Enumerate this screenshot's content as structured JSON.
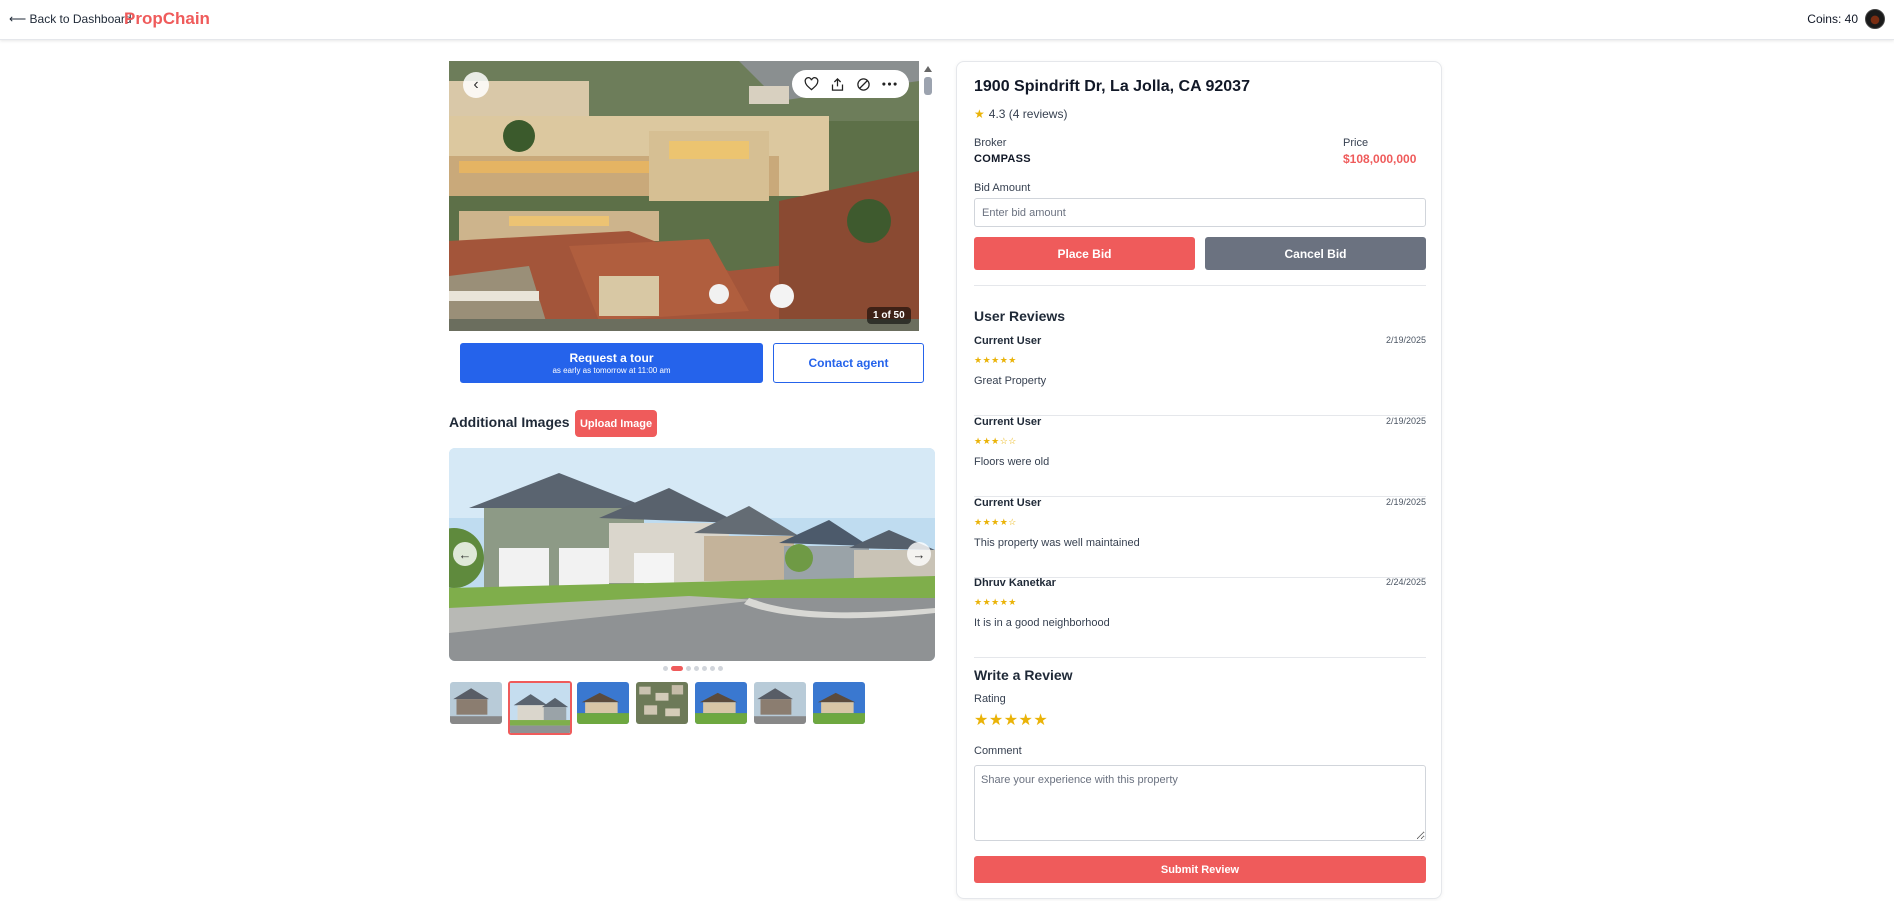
{
  "header": {
    "back_label": "⟵ Back to Dashboard",
    "brand": "PropChain",
    "coins_label": "Coins: 40"
  },
  "hero": {
    "counter": "1 of 50"
  },
  "actions": {
    "tour_title": "Request a tour",
    "tour_subtitle": "as early as tomorrow at 11:00 am",
    "contact_label": "Contact agent"
  },
  "additional_images": {
    "title": "Additional Images",
    "upload_label": "Upload Image",
    "prev_arrow": "←",
    "next_arrow": "→",
    "active_slide": 2,
    "slide_count": 7,
    "thumbnail_count": 7
  },
  "property": {
    "address": "1900 Spindrift Dr, La Jolla, CA 92037",
    "rating_star": "★",
    "rating_text": "4.3 (4 reviews)",
    "broker_label": "Broker",
    "broker_value": "COMPASS",
    "price_label": "Price",
    "price_value": "$108,000,000"
  },
  "bid": {
    "label": "Bid Amount",
    "placeholder": "Enter bid amount",
    "place_label": "Place Bid",
    "cancel_label": "Cancel Bid"
  },
  "reviews": {
    "title": "User Reviews",
    "items": [
      {
        "name": "Current User",
        "date": "2/19/2025",
        "stars": "★★★★★",
        "rating": 5,
        "text": "Great Property"
      },
      {
        "name": "Current User",
        "date": "2/19/2025",
        "stars": "★★★☆☆",
        "rating": 3,
        "text": "Floors were old"
      },
      {
        "name": "Current User",
        "date": "2/19/2025",
        "stars": "★★★★☆",
        "rating": 4,
        "text": "This property was well maintained"
      },
      {
        "name": "Dhruv Kanetkar",
        "date": "2/24/2025",
        "stars": "★★★★★",
        "rating": 5,
        "text": "It is in a good neighborhood"
      }
    ]
  },
  "write_review": {
    "title": "Write a Review",
    "rating_label": "Rating",
    "rating_stars": [
      "★",
      "★",
      "★",
      "★",
      "★"
    ],
    "comment_label": "Comment",
    "comment_placeholder": "Share your experience with this property",
    "submit_label": "Submit Review"
  },
  "colors": {
    "brand": "#ef5b5b",
    "primary_blue": "#2563eb",
    "cancel_gray": "#6b7280",
    "star": "#eab308"
  }
}
